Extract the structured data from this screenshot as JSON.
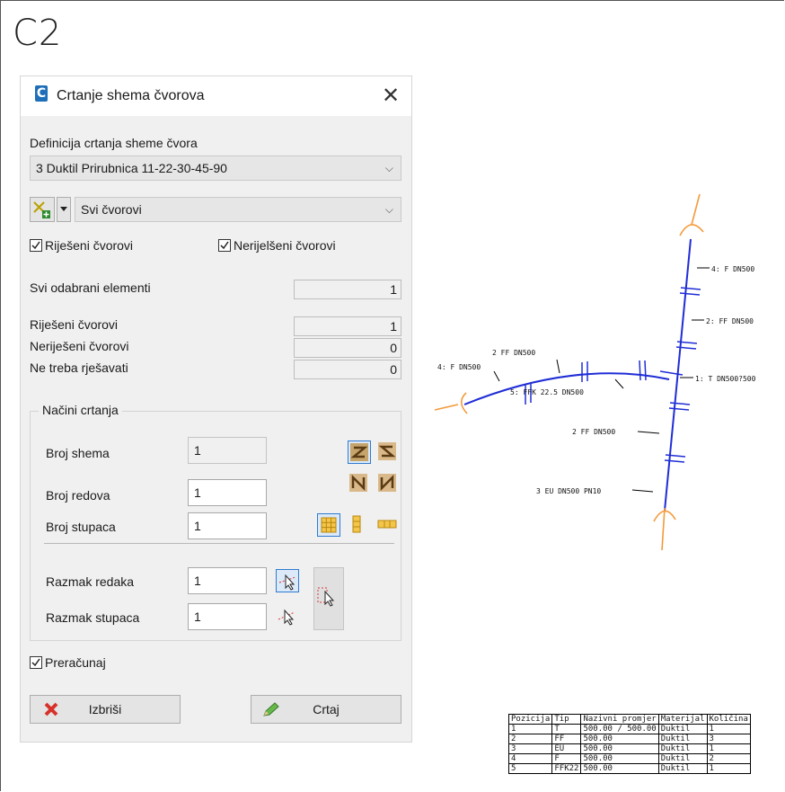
{
  "slide_label": "C2",
  "dialog": {
    "title": "Crtanje shema čvorova",
    "close_glyph": "✕",
    "app_icon_letter": "C",
    "definition_label": "Definicija crtanja sheme čvora",
    "definition_value": "3 Duktil Prirubnica 11-22-30-45-90",
    "selector_value": "Svi čvorovi",
    "chk_resolved": "Riješeni čvorovi",
    "chk_unresolved": "Nerijelšeni čvorovi",
    "all_selected_label": "Svi odabrani elementi",
    "all_selected_value": "1",
    "stats": [
      {
        "label": "Riješeni čvorovi",
        "value": "1"
      },
      {
        "label": "Neriješeni čvorovi",
        "value": "0"
      },
      {
        "label": "Ne treba rješavati",
        "value": "0"
      }
    ],
    "group_title": "Načini crtanja",
    "broj_shema_label": "Broj shema",
    "broj_shema_value": "1",
    "broj_redova_label": "Broj redova",
    "broj_redova_value": "1",
    "broj_stupaca_label": "Broj stupaca",
    "broj_stupaca_value": "1",
    "razmak_redaka_label": "Razmak redaka",
    "razmak_redaka_value": "1",
    "razmak_stupaca_label": "Razmak stupaca",
    "razmak_stupaca_value": "1",
    "recalc_label": "Preračunaj",
    "delete_label": "Izbriši",
    "draw_label": "Crtaj"
  },
  "drawing_labels": {
    "l1": "4: F  DN500",
    "l2": "2: FF  DN500",
    "l3": "1: T  DN500?500",
    "l4": "2  FF  DN500",
    "l5": "4: F  DN500",
    "l6": "5: FFK 22.5 DN500",
    "l7": "2 FF  DN500",
    "l8": "3 EU  DN500 PN10"
  },
  "bom": {
    "headers": [
      "Pozicija",
      "Tip",
      "Nazivni promjer",
      "Materijal",
      "Količina"
    ],
    "rows": [
      [
        "1",
        "T",
        "500.00 / 500.00",
        "Duktil",
        "1"
      ],
      [
        "2",
        "FF",
        "500.00",
        "Duktil",
        "3"
      ],
      [
        "3",
        "EU",
        "500.00",
        "Duktil",
        "1"
      ],
      [
        "4",
        "F",
        "500.00",
        "Duktil",
        "2"
      ],
      [
        "5",
        "FFK22",
        "500.00",
        "Duktil",
        "1"
      ]
    ]
  },
  "colors": {
    "pipe": "#1f2dd6",
    "connector": "#f39a3a",
    "selected_border": "#2f7bd1"
  }
}
